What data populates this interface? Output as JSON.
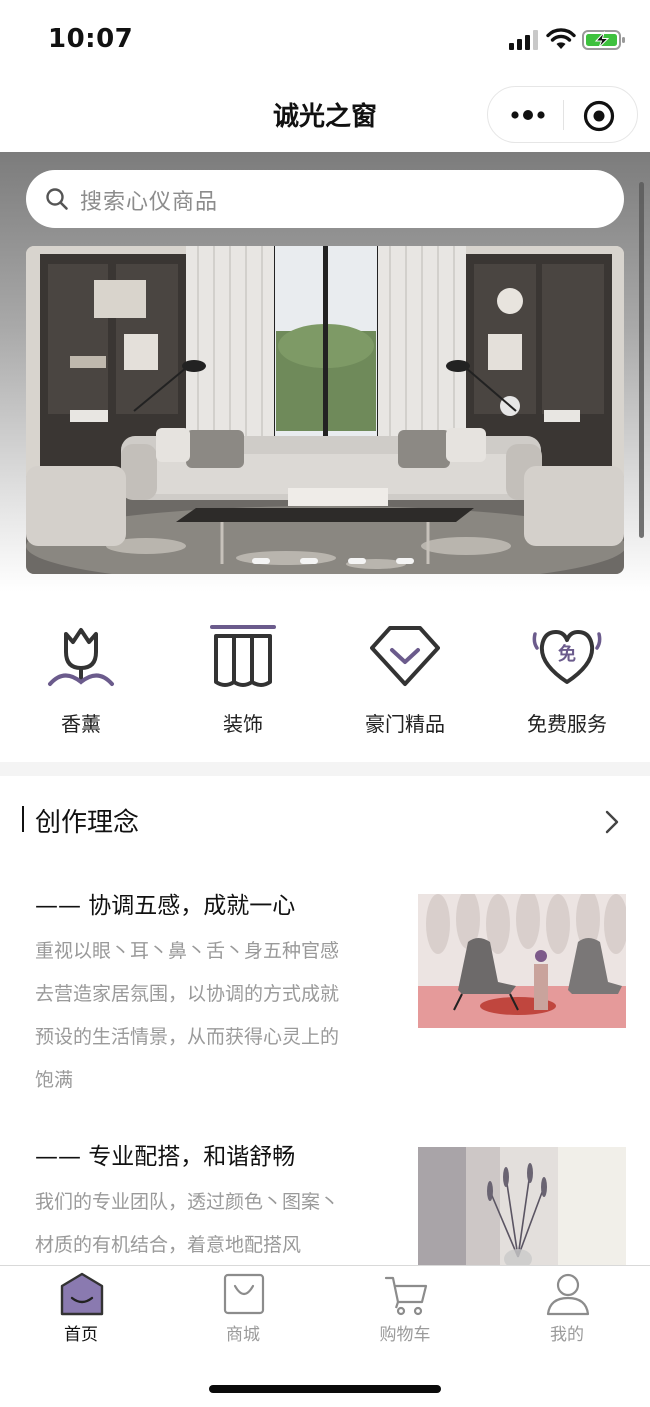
{
  "status": {
    "time": "10:07"
  },
  "nav": {
    "title": "诚光之窗"
  },
  "search": {
    "placeholder": "搜索心仪商品"
  },
  "banner": {
    "slides": 4,
    "active_slide": 1
  },
  "categories": [
    {
      "label": "香薰",
      "icon": "tulip-icon"
    },
    {
      "label": "装饰",
      "icon": "curtain-icon"
    },
    {
      "label": "豪门精品",
      "icon": "diamond-icon"
    },
    {
      "label": "免费服务",
      "icon": "free-heart-icon"
    }
  ],
  "section": {
    "title": "创作理念"
  },
  "articles": [
    {
      "title": "—— 协调五感，成就一心",
      "body": "重视以眼丶耳丶鼻丶舌丶身五种官感去营造家居氛围，以协调的方式成就预设的生活情景，从而获得心灵上的饱满"
    },
    {
      "title": "—— 专业配搭，和谐舒畅",
      "body": "我们的专业团队，透过颜色丶图案丶材质的有机结合，着意地配搭风"
    }
  ],
  "tabbar": {
    "items": [
      {
        "label": "首页",
        "icon": "home-icon",
        "active": true
      },
      {
        "label": "商城",
        "icon": "bag-icon",
        "active": false
      },
      {
        "label": "购物车",
        "icon": "cart-icon",
        "active": false
      },
      {
        "label": "我的",
        "icon": "user-icon",
        "active": false
      }
    ]
  },
  "colors": {
    "accent": "#6b5b8c",
    "accent_fill": "#8a7ab0",
    "text_muted": "#9a9a9a"
  }
}
